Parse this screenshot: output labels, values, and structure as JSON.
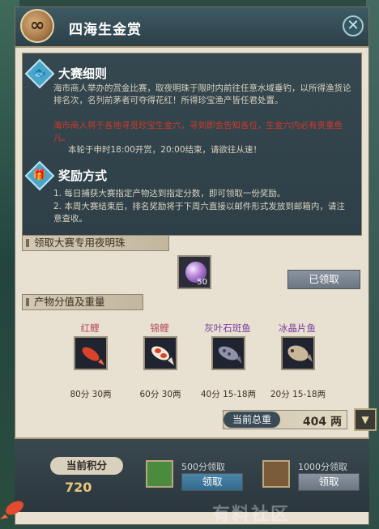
{
  "window": {
    "title": "四海生金赏",
    "logo_glyph": "∞"
  },
  "rules_section": {
    "title": "大赛细则",
    "icon": "fish-icon",
    "para1": "海市商人举办的赏金比赛，取夜明珠于限时内前往任意水域垂钓，以所得渔货论排名次，名列前茅者可夺得花红！所得珍宝渔产皆任君处置。",
    "para2_red": "海市商人将于各地寻觅珍宝生金六，寻到即会告知各位，生金六内必有贵重鱼儿。",
    "para3": "本轮于申时18:00开赏，20:00结束，请欲往从速！"
  },
  "reward_section": {
    "title": "奖励方式",
    "icon": "gift-icon",
    "line1": "1. 每日捕获大赛指定产物达到指定分数，即可领取一份奖励。",
    "line2": "2. 本周大赛结束后，排名奖励将于下周六直接以邮件形式发放到邮箱内，请注意查收。"
  },
  "pearl_section": {
    "header": "领取大赛专用夜明珠",
    "item_count": "50",
    "button_label": "已领取"
  },
  "fish_section": {
    "header": "产物分值及重量",
    "fish": [
      {
        "name": "红鲤",
        "name_color": "#b44a5c",
        "score": "80分",
        "weight": "30两"
      },
      {
        "name": "锦鲤",
        "name_color": "#b44a5c",
        "score": "60分",
        "weight": "30两"
      },
      {
        "name": "灰叶石斑鱼",
        "name_color": "#7a3fa0",
        "score": "40分",
        "weight": "15-18两"
      },
      {
        "name": "冰晶片鱼",
        "name_color": "#7a3fa0",
        "score": "20分",
        "weight": "15-18两"
      }
    ],
    "total_label": "当前总重",
    "total_value": "404 两"
  },
  "bottom_bar": {
    "score_label": "当前积分",
    "score_value": "720",
    "reward1": {
      "label": "500分领取",
      "button": "领取"
    },
    "reward2": {
      "label": "1000分领取",
      "button": "领取"
    },
    "watermark": "有料社区"
  },
  "colors": {
    "accent": "#4aa6c9",
    "panel": "#e8e1d1",
    "dark": "#2c4048"
  }
}
